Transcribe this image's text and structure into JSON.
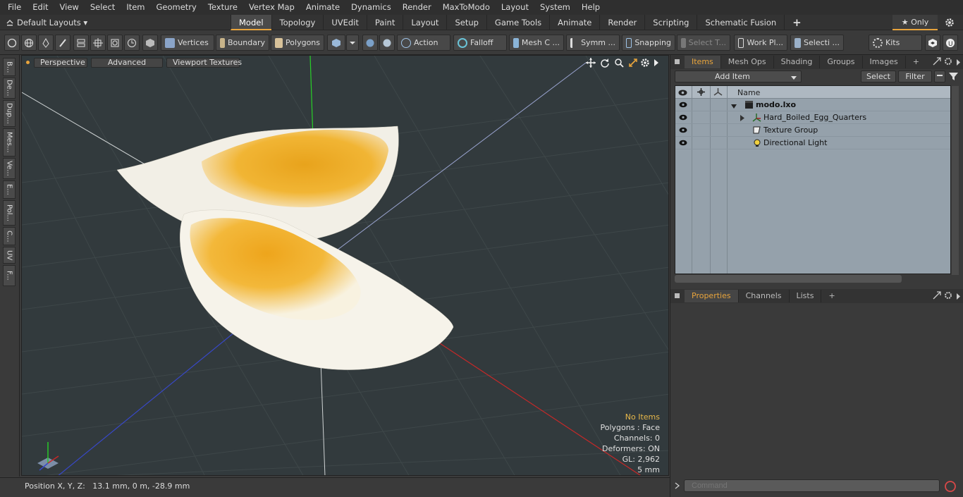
{
  "menubar": {
    "items": [
      "File",
      "Edit",
      "View",
      "Select",
      "Item",
      "Geometry",
      "Texture",
      "Vertex Map",
      "Animate",
      "Dynamics",
      "Render",
      "MaxToModo",
      "Layout",
      "System",
      "Help"
    ]
  },
  "layout_selector": {
    "label": "Default Layouts ▾"
  },
  "layout_tabs": [
    {
      "label": "Model",
      "active": true
    },
    {
      "label": "Topology"
    },
    {
      "label": "UVEdit"
    },
    {
      "label": "Paint"
    },
    {
      "label": "Layout"
    },
    {
      "label": "Setup"
    },
    {
      "label": "Game Tools"
    },
    {
      "label": "Animate"
    },
    {
      "label": "Render"
    },
    {
      "label": "Scripting"
    },
    {
      "label": "Schematic Fusion"
    }
  ],
  "tabbar_right": {
    "add": "+",
    "only": "★ Only"
  },
  "toolbar": {
    "vertices": "Vertices",
    "boundary": "Boundary",
    "polygons": "Polygons",
    "action": "Action",
    "falloff": "Falloff",
    "mesh": "Mesh C ...",
    "symm": "Symm ...",
    "snapping": "Snapping",
    "select_t": "Select T...",
    "work_plane": "Work Pl...",
    "selection": "Selecti ...",
    "kits": "Kits"
  },
  "left_tabs": [
    "B...",
    "De...",
    "Dup...",
    "Mes...",
    "Ve...",
    "E...",
    "Pol...",
    "C...",
    "UV",
    "F..."
  ],
  "viewport": {
    "perspective": "Perspective",
    "advanced": "Advanced",
    "viewport_textures": "Viewport Textures",
    "info": {
      "no_items": "No Items",
      "polygons": "Polygons : Face",
      "channels": "Channels: 0",
      "deformers": "Deformers: ON",
      "gl": "GL: 2,962",
      "scale": "5 mm"
    }
  },
  "statusbar": {
    "position": "Position X, Y, Z:   13.1 mm, 0 m, -28.9 mm"
  },
  "items_panel": {
    "tabs": [
      {
        "label": "Items",
        "active": true
      },
      {
        "label": "Mesh Ops"
      },
      {
        "label": "Shading"
      },
      {
        "label": "Groups"
      },
      {
        "label": "Images"
      }
    ],
    "add_tab": "+",
    "add_item": "Add Item",
    "select": "Select",
    "filter": "Filter",
    "name_header": "Name",
    "rows": [
      {
        "name": "modo.lxo"
      },
      {
        "name": "Hard_Boiled_Egg_Quarters"
      },
      {
        "name": "Texture Group"
      },
      {
        "name": "Directional Light"
      }
    ]
  },
  "properties_panel": {
    "tabs": [
      {
        "label": "Properties",
        "active": true
      },
      {
        "label": "Channels"
      },
      {
        "label": "Lists"
      }
    ],
    "add_tab": "+"
  },
  "command": {
    "placeholder": "Command"
  },
  "colors": {
    "accent": "#e8a43c",
    "list_bg": "#95a1ab",
    "viewport_bg": "#323a3d"
  }
}
